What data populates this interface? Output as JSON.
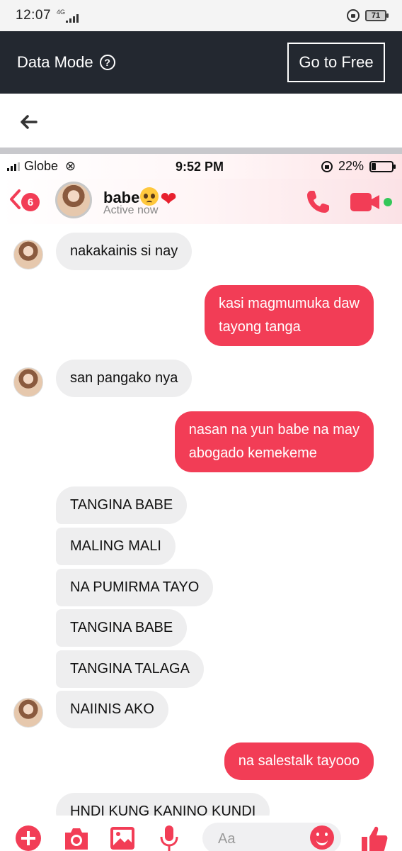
{
  "outer_status": {
    "time": "12:07",
    "network": "4G",
    "battery": "71"
  },
  "banner": {
    "label": "Data Mode",
    "help_glyph": "?",
    "button": "Go to Free"
  },
  "inner_status": {
    "carrier": "Globe",
    "time": "9:52 PM",
    "battery": "22%",
    "battery_level": 0.22
  },
  "chat_header": {
    "unread_count": "6",
    "contact_name": "babe",
    "status": "Active now"
  },
  "messages": [
    {
      "side": "in",
      "text": "nakakainis si nay"
    },
    {
      "side": "out",
      "text": "kasi magmumuka daw tayong tanga",
      "lines": [
        "kasi magmumuka daw",
        "tayong tanga"
      ]
    },
    {
      "side": "in",
      "text": "san pangako nya"
    },
    {
      "side": "out",
      "text": "nasan na yun babe na may abogado kemekeme",
      "lines": [
        "nasan na yun babe na may",
        "abogado kemekeme"
      ]
    },
    {
      "side": "in",
      "text": "TANGINA BABE"
    },
    {
      "side": "in",
      "text": "MALING MALI"
    },
    {
      "side": "in",
      "text": "NA PUMIRMA TAYO"
    },
    {
      "side": "in",
      "text": "TANGINA BABE"
    },
    {
      "side": "in",
      "text": "TANGINA TALAGA"
    },
    {
      "side": "in",
      "text": "NAIINIS AKO"
    },
    {
      "side": "out",
      "text": "na salestalk tayooo"
    },
    {
      "side": "in",
      "text": "HNDI KUNG KANINO KUNDI"
    }
  ],
  "composer": {
    "placeholder": "Aa"
  },
  "colors": {
    "accent": "#f23d56",
    "banner_bg": "#232830",
    "incoming_bubble": "#eeeeef"
  },
  "icons": [
    "back-arrow-icon",
    "help-icon",
    "signal-icon",
    "link-icon",
    "rotation-lock-icon",
    "battery-icon",
    "chevron-left-icon",
    "phone-icon",
    "video-camera-icon",
    "plus-icon",
    "camera-icon",
    "gallery-icon",
    "microphone-icon",
    "emoji-icon",
    "thumbs-up-icon"
  ]
}
